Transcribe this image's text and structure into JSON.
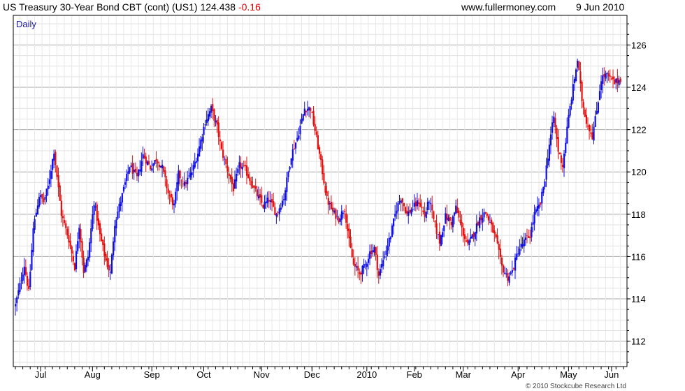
{
  "header": {
    "title": "US Treasury 30-Year  Bond CBT (cont) (US1) 124.438",
    "change": "-0.16",
    "site": "www.fullermoney.com",
    "date": "9 Jun 2010"
  },
  "footer": {
    "copyright": "© 2010 Stockcube Research Ltd"
  },
  "colors": {
    "up": "#1010e0",
    "down": "#e01010",
    "grid": "#c8c8c8",
    "frame": "#000000"
  },
  "chart_data": {
    "type": "candlestick",
    "period_label": "Daily",
    "ylim": [
      110.8,
      127.4
    ],
    "y_ticks": [
      112,
      114,
      116,
      118,
      120,
      122,
      124,
      126
    ],
    "x_labels": [
      "Jul",
      "Aug",
      "Sep",
      "Oct",
      "Nov",
      "Dec",
      "2010",
      "Feb",
      "Mar",
      "Apr",
      "May",
      "Jun"
    ],
    "x_label_days": [
      17,
      52,
      92,
      127,
      166,
      200,
      237,
      269,
      302,
      339,
      373,
      402
    ],
    "day_range": [
      0,
      411
    ],
    "closes": [
      [
        0,
        113.7
      ],
      [
        6,
        115.6
      ],
      [
        9,
        114.3
      ],
      [
        12,
        117.3
      ],
      [
        16,
        118.9
      ],
      [
        19,
        118.6
      ],
      [
        22,
        119.3
      ],
      [
        26,
        121.0
      ],
      [
        31,
        118.0
      ],
      [
        36,
        116.8
      ],
      [
        40,
        115.5
      ],
      [
        43,
        117.5
      ],
      [
        46,
        115.3
      ],
      [
        49,
        116.0
      ],
      [
        53,
        118.6
      ],
      [
        57,
        117.0
      ],
      [
        61,
        115.8
      ],
      [
        64,
        115.2
      ],
      [
        67,
        117.6
      ],
      [
        72,
        118.9
      ],
      [
        77,
        120.3
      ],
      [
        82,
        119.7
      ],
      [
        86,
        120.8
      ],
      [
        91,
        120.2
      ],
      [
        95,
        120.6
      ],
      [
        99,
        120.2
      ],
      [
        103,
        119.0
      ],
      [
        107,
        118.4
      ],
      [
        110,
        119.9
      ],
      [
        114,
        119.4
      ],
      [
        119,
        120.0
      ],
      [
        123,
        120.9
      ],
      [
        128,
        122.4
      ],
      [
        132,
        123.0
      ],
      [
        136,
        122.1
      ],
      [
        139,
        121.0
      ],
      [
        143,
        120.1
      ],
      [
        147,
        119.2
      ],
      [
        151,
        120.3
      ],
      [
        155,
        120.1
      ],
      [
        159,
        119.5
      ],
      [
        163,
        118.9
      ],
      [
        167,
        118.4
      ],
      [
        171,
        118.7
      ],
      [
        176,
        118.0
      ],
      [
        181,
        118.8
      ],
      [
        186,
        120.8
      ],
      [
        190,
        121.6
      ],
      [
        195,
        123.0
      ],
      [
        199,
        123.0
      ],
      [
        203,
        121.6
      ],
      [
        207,
        120.0
      ],
      [
        210,
        118.7
      ],
      [
        214,
        118.1
      ],
      [
        218,
        117.8
      ],
      [
        222,
        118.3
      ],
      [
        225,
        116.7
      ],
      [
        228,
        115.6
      ],
      [
        232,
        115.2
      ],
      [
        236,
        115.6
      ],
      [
        239,
        116.2
      ],
      [
        242,
        116.4
      ],
      [
        245,
        115.1
      ],
      [
        249,
        116.1
      ],
      [
        253,
        117.0
      ],
      [
        257,
        118.3
      ],
      [
        260,
        118.8
      ],
      [
        264,
        118.0
      ],
      [
        268,
        118.3
      ],
      [
        272,
        118.6
      ],
      [
        276,
        117.9
      ],
      [
        279,
        118.7
      ],
      [
        282,
        117.7
      ],
      [
        286,
        116.7
      ],
      [
        290,
        117.9
      ],
      [
        294,
        117.6
      ],
      [
        297,
        118.3
      ],
      [
        301,
        117.3
      ],
      [
        305,
        116.5
      ],
      [
        309,
        117.1
      ],
      [
        313,
        117.8
      ],
      [
        317,
        118.1
      ],
      [
        321,
        117.4
      ],
      [
        324,
        116.8
      ],
      [
        328,
        115.5
      ],
      [
        332,
        115.0
      ],
      [
        335,
        115.3
      ],
      [
        339,
        116.3
      ],
      [
        343,
        116.7
      ],
      [
        347,
        117.0
      ],
      [
        350,
        118.0
      ],
      [
        354,
        118.5
      ],
      [
        357,
        119.7
      ],
      [
        360,
        121.3
      ],
      [
        363,
        122.6
      ],
      [
        366,
        121.0
      ],
      [
        369,
        120.3
      ],
      [
        373,
        122.6
      ],
      [
        376,
        124.0
      ],
      [
        379,
        125.3
      ],
      [
        382,
        123.4
      ],
      [
        385,
        122.4
      ],
      [
        389,
        121.7
      ],
      [
        392,
        122.9
      ],
      [
        395,
        124.4
      ],
      [
        398,
        124.6
      ],
      [
        401,
        124.4
      ],
      [
        404,
        124.2
      ],
      [
        408,
        124.4
      ]
    ]
  }
}
